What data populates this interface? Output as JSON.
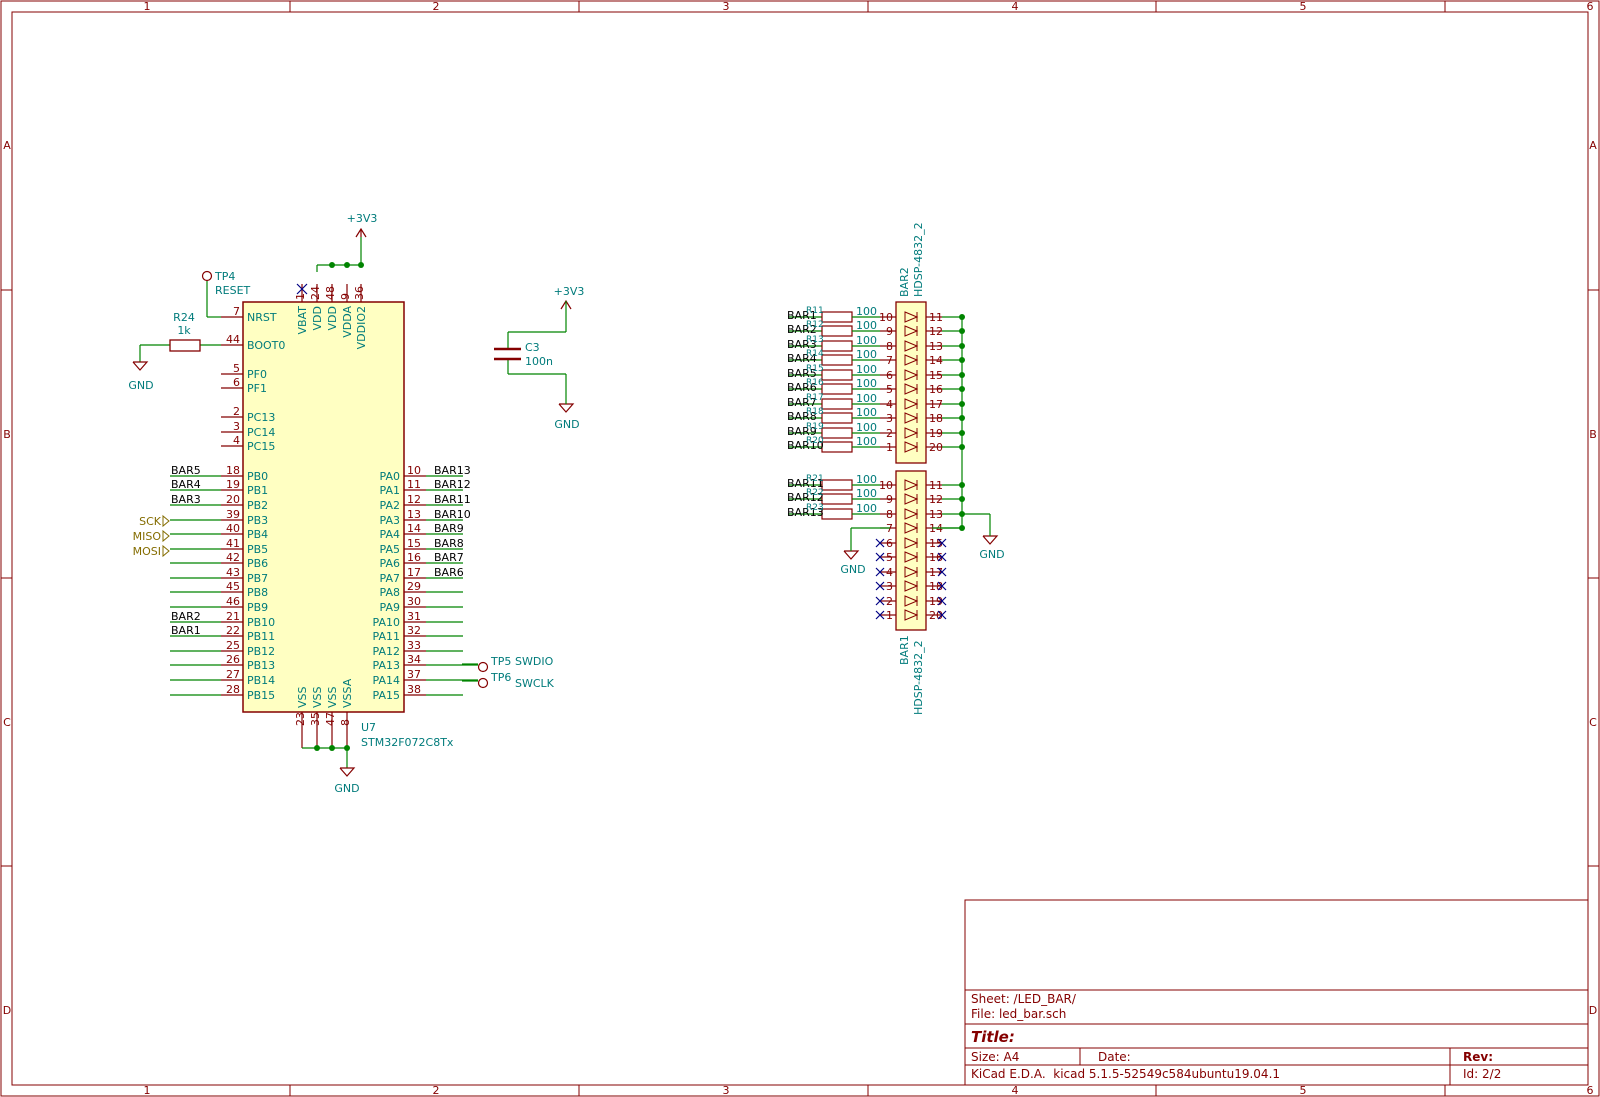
{
  "frame": {
    "columns": [
      "1",
      "2",
      "3",
      "4",
      "5",
      "6"
    ],
    "rows": [
      "A",
      "B",
      "C",
      "D"
    ]
  },
  "title_block": {
    "sheet_label": "Sheet: /LED_BAR/",
    "file_label": "File: led_bar.sch",
    "title_label": "Title:",
    "size_label": "Size: A4",
    "date_label": "Date:",
    "rev_label": "Rev:",
    "tool_label": "KiCad E.D.A.  kicad 5.1.5-52549c584ubuntu19.04.1",
    "id_label": "Id: 2/2"
  },
  "mcu": {
    "ref": "U7",
    "value": "STM32F072C8Tx",
    "left_pins": [
      {
        "name": "NRST",
        "num": "7",
        "net": ""
      },
      {
        "name": "BOOT0",
        "num": "44",
        "net": ""
      },
      {
        "name": "PF0",
        "num": "5",
        "net": ""
      },
      {
        "name": "PF1",
        "num": "6",
        "net": ""
      },
      {
        "name": "PC13",
        "num": "2",
        "net": ""
      },
      {
        "name": "PC14",
        "num": "3",
        "net": ""
      },
      {
        "name": "PC15",
        "num": "4",
        "net": ""
      },
      {
        "name": "PB0",
        "num": "18",
        "net": "BAR5"
      },
      {
        "name": "PB1",
        "num": "19",
        "net": "BAR4"
      },
      {
        "name": "PB2",
        "num": "20",
        "net": "BAR3"
      },
      {
        "name": "PB3",
        "num": "39",
        "net": ""
      },
      {
        "name": "PB4",
        "num": "40",
        "net": ""
      },
      {
        "name": "PB5",
        "num": "41",
        "net": ""
      },
      {
        "name": "PB6",
        "num": "42",
        "net": ""
      },
      {
        "name": "PB7",
        "num": "43",
        "net": ""
      },
      {
        "name": "PB8",
        "num": "45",
        "net": ""
      },
      {
        "name": "PB9",
        "num": "46",
        "net": ""
      },
      {
        "name": "PB10",
        "num": "21",
        "net": "BAR2"
      },
      {
        "name": "PB11",
        "num": "22",
        "net": "BAR1"
      },
      {
        "name": "PB12",
        "num": "25",
        "net": ""
      },
      {
        "name": "PB13",
        "num": "26",
        "net": ""
      },
      {
        "name": "PB14",
        "num": "27",
        "net": ""
      },
      {
        "name": "PB15",
        "num": "28",
        "net": ""
      }
    ],
    "right_pins": [
      {
        "name": "PA0",
        "num": "10",
        "net": "BAR13"
      },
      {
        "name": "PA1",
        "num": "11",
        "net": "BAR12"
      },
      {
        "name": "PA2",
        "num": "12",
        "net": "BAR11"
      },
      {
        "name": "PA3",
        "num": "13",
        "net": "BAR10"
      },
      {
        "name": "PA4",
        "num": "14",
        "net": "BAR9"
      },
      {
        "name": "PA5",
        "num": "15",
        "net": "BAR8"
      },
      {
        "name": "PA6",
        "num": "16",
        "net": "BAR7"
      },
      {
        "name": "PA7",
        "num": "17",
        "net": "BAR6"
      },
      {
        "name": "PA8",
        "num": "29",
        "net": ""
      },
      {
        "name": "PA9",
        "num": "30",
        "net": ""
      },
      {
        "name": "PA10",
        "num": "31",
        "net": ""
      },
      {
        "name": "PA11",
        "num": "32",
        "net": ""
      },
      {
        "name": "PA12",
        "num": "33",
        "net": ""
      },
      {
        "name": "PA13",
        "num": "34",
        "net": ""
      },
      {
        "name": "PA14",
        "num": "37",
        "net": ""
      },
      {
        "name": "PA15",
        "num": "38",
        "net": ""
      }
    ],
    "top_pins": [
      {
        "name": "VBAT",
        "num": "1"
      },
      {
        "name": "VDD",
        "num": "24"
      },
      {
        "name": "VDD",
        "num": "48"
      },
      {
        "name": "VDDA",
        "num": "9"
      },
      {
        "name": "VDDIO2",
        "num": "36"
      }
    ],
    "bottom_pins": [
      {
        "name": "VSS",
        "num": "23"
      },
      {
        "name": "VSS",
        "num": "35"
      },
      {
        "name": "VSS",
        "num": "47"
      },
      {
        "name": "VSSA",
        "num": "8"
      }
    ]
  },
  "power": {
    "v33": "+3V3",
    "gnd": "GND"
  },
  "r24": {
    "ref": "R24",
    "value": "1k"
  },
  "c3": {
    "ref": "C3",
    "value": "100n"
  },
  "tp4": {
    "ref": "TP4",
    "label": "RESET"
  },
  "tp5": {
    "ref": "TP5",
    "label": "SWDIO"
  },
  "tp6": {
    "ref": "TP6",
    "label": "SWCLK"
  },
  "hier_labels": [
    "SCK",
    "MISO",
    "MOSI"
  ],
  "bar2": {
    "ref": "BAR2",
    "value": "HDSP-4832_2"
  },
  "bar1": {
    "ref": "BAR1",
    "value": "HDSP-4832_2"
  },
  "bar2_rows": [
    {
      "net": "BAR1",
      "res_ref": "R11",
      "res_val": "100",
      "pin_l": "10",
      "pin_r": "11"
    },
    {
      "net": "BAR2",
      "res_ref": "R12",
      "res_val": "100",
      "pin_l": "9",
      "pin_r": "12"
    },
    {
      "net": "BAR3",
      "res_ref": "R13",
      "res_val": "100",
      "pin_l": "8",
      "pin_r": "13"
    },
    {
      "net": "BAR4",
      "res_ref": "R14",
      "res_val": "100",
      "pin_l": "7",
      "pin_r": "14"
    },
    {
      "net": "BAR5",
      "res_ref": "R15",
      "res_val": "100",
      "pin_l": "6",
      "pin_r": "15"
    },
    {
      "net": "BAR6",
      "res_ref": "R16",
      "res_val": "100",
      "pin_l": "5",
      "pin_r": "16"
    },
    {
      "net": "BAR7",
      "res_ref": "R17",
      "res_val": "100",
      "pin_l": "4",
      "pin_r": "17"
    },
    {
      "net": "BAR8",
      "res_ref": "R18",
      "res_val": "100",
      "pin_l": "3",
      "pin_r": "18"
    },
    {
      "net": "BAR9",
      "res_ref": "R19",
      "res_val": "100",
      "pin_l": "2",
      "pin_r": "19"
    },
    {
      "net": "BAR10",
      "res_ref": "R20",
      "res_val": "100",
      "pin_l": "1",
      "pin_r": "20"
    }
  ],
  "bar1_rows": [
    {
      "net": "BAR11",
      "res_ref": "R21",
      "res_val": "100",
      "pin_l": "10",
      "pin_r": "11"
    },
    {
      "net": "BAR12",
      "res_ref": "R22",
      "res_val": "100",
      "pin_l": "9",
      "pin_r": "12"
    },
    {
      "net": "BAR13",
      "res_ref": "R23",
      "res_val": "100",
      "pin_l": "8",
      "pin_r": "13"
    },
    {
      "net": "",
      "res_ref": "",
      "res_val": "",
      "pin_l": "7",
      "pin_r": "14"
    },
    {
      "net": "",
      "res_ref": "",
      "res_val": "",
      "pin_l": "6",
      "pin_r": "15"
    },
    {
      "net": "",
      "res_ref": "",
      "res_val": "",
      "pin_l": "5",
      "pin_r": "16"
    },
    {
      "net": "",
      "res_ref": "",
      "res_val": "",
      "pin_l": "4",
      "pin_r": "17"
    },
    {
      "net": "",
      "res_ref": "",
      "res_val": "",
      "pin_l": "3",
      "pin_r": "18"
    },
    {
      "net": "",
      "res_ref": "",
      "res_val": "",
      "pin_l": "2",
      "pin_r": "19"
    },
    {
      "net": "",
      "res_ref": "",
      "res_val": "",
      "pin_l": "1",
      "pin_r": "20"
    }
  ],
  "colors": {
    "frame": "#840000",
    "body_fill": "#ffffc2",
    "wire": "#008400",
    "text_teal": "#007b7b",
    "junction": "#008400",
    "noconnect": "#000084"
  }
}
